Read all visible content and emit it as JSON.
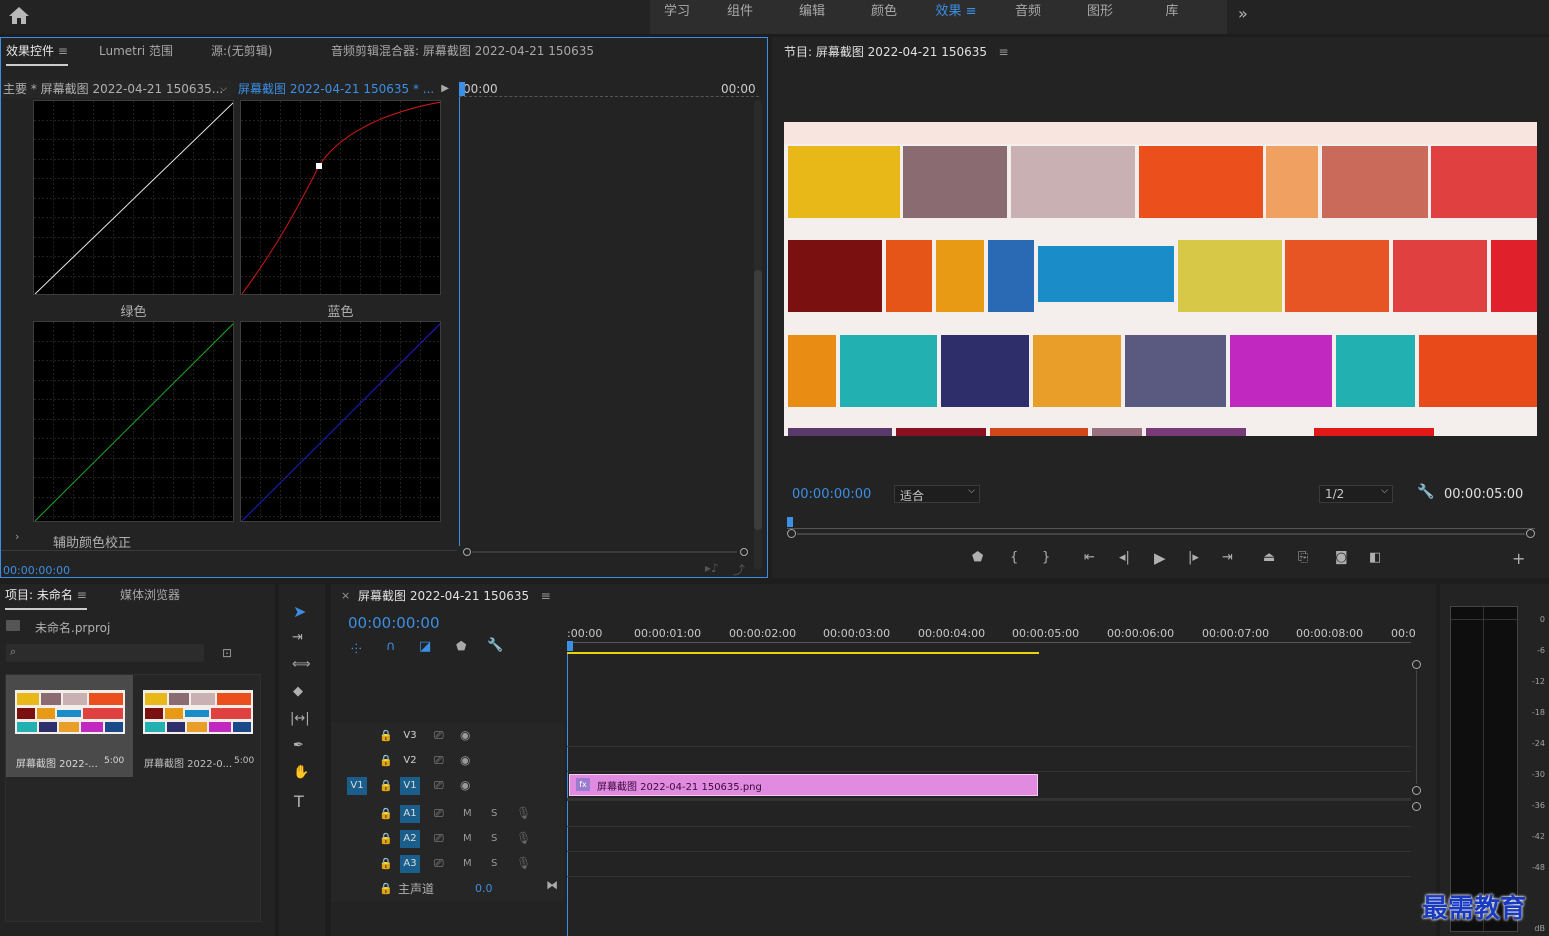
{
  "workspace": {
    "tabs": [
      "学习",
      "组件",
      "编辑",
      "颜色",
      "效果",
      "音频",
      "图形",
      "库"
    ],
    "active": "效果",
    "more": "»"
  },
  "effects_panel": {
    "tabs": [
      "效果控件",
      "Lumetri 范围",
      "源:(无剪辑)",
      "音频剪辑混合器: 屏幕截图 2022-04-21 150635"
    ],
    "master_label": "主要 * 屏幕截图 2022-04-21 150635...",
    "clip_label": "屏幕截图 2022-04-21 150635 * ...",
    "time_start": "00:00",
    "time_end": "00:00",
    "curve_labels": {
      "green": "绿色",
      "blue": "蓝色"
    },
    "section": "辅助颜色校正",
    "timecode": "00:00:00:00"
  },
  "program_monitor": {
    "title": "节目: 屏幕截图 2022-04-21 150635",
    "timecode": "00:00:00:00",
    "fit": "适合",
    "resolution": "1/2",
    "duration": "00:00:05:00"
  },
  "project_panel": {
    "tabs": [
      "项目: 未命名",
      "媒体浏览器"
    ],
    "project_file": "未命名.prproj",
    "items": [
      {
        "name": "屏幕截图 2022-...",
        "duration": "5:00"
      },
      {
        "name": "屏幕截图 2022-0...",
        "duration": "5:00"
      }
    ]
  },
  "timeline": {
    "title": "屏幕截图 2022-04-21 150635",
    "timecode": "00:00:00:00",
    "ruler": [
      ":00:00",
      "00:00:01:00",
      "00:00:02:00",
      "00:00:03:00",
      "00:00:04:00",
      "00:00:05:00",
      "00:00:06:00",
      "00:00:07:00",
      "00:00:08:00",
      "00:0"
    ],
    "video_tracks": [
      "V3",
      "V2",
      "V1"
    ],
    "audio_tracks": [
      "A1",
      "A2",
      "A3"
    ],
    "source_patch": "V1",
    "master": {
      "label": "主声道",
      "value": "0.0"
    },
    "clip": {
      "label": "屏幕截图 2022-04-21 150635.png",
      "fx": "fx"
    }
  },
  "audio_meter": {
    "scale": [
      "0",
      "-6",
      "-12",
      "-18",
      "-24",
      "-30",
      "-36",
      "-42",
      "-48",
      "dB"
    ]
  },
  "watermark": "最需教育",
  "colors": {
    "accent": "#3b8fe4",
    "clip": "#e08ae0",
    "work_area": "#e8d400",
    "v1_target": "#1a5e8c"
  },
  "icons": [
    "home-icon",
    "hamburger-icon",
    "chevron-right-icon",
    "play-icon",
    "step-back-icon",
    "step-forward-icon",
    "go-to-in-icon",
    "go-to-out-icon",
    "marker-icon",
    "in-point-icon",
    "out-point-icon",
    "lift-icon",
    "extract-icon",
    "camera-icon",
    "compare-icon",
    "plus-icon",
    "wrench-icon",
    "selection-tool-icon",
    "track-select-icon",
    "ripple-edit-icon",
    "razor-icon",
    "slip-icon",
    "pen-icon",
    "hand-icon",
    "type-icon",
    "lock-icon",
    "toggle-output-icon",
    "eye-icon",
    "microphone-icon",
    "folder-icon",
    "search-icon",
    "snap-icon",
    "linked-icon",
    "add-marker-icon"
  ]
}
